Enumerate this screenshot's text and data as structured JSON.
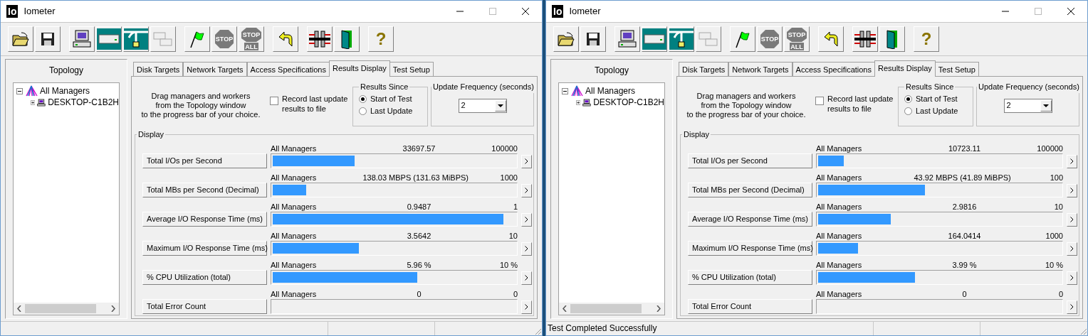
{
  "windows": [
    {
      "title": "Iometer",
      "logo": "Io",
      "toolbar": [
        [
          {
            "kind": "open",
            "disabled": false
          },
          {
            "kind": "save",
            "disabled": false
          }
        ],
        [
          {
            "kind": "manager",
            "disabled": false
          },
          {
            "kind": "disk-worker",
            "disabled": false
          },
          {
            "kind": "network-worker",
            "disabled": false
          },
          {
            "kind": "duplicate",
            "disabled": true
          }
        ],
        [
          {
            "kind": "start",
            "disabled": false
          },
          {
            "kind": "stop",
            "disabled": true,
            "text": "STOP"
          },
          {
            "kind": "stop-all",
            "disabled": true,
            "text": "STOP",
            "subtext": "ALL"
          }
        ],
        [
          {
            "kind": "reset",
            "disabled": false
          }
        ],
        [
          {
            "kind": "workers",
            "disabled": false
          },
          {
            "kind": "exit",
            "disabled": false
          }
        ],
        [
          {
            "kind": "help",
            "disabled": false,
            "text": "?"
          }
        ]
      ],
      "topology": {
        "title": "Topology",
        "tree": [
          {
            "label": "All Managers",
            "expanded": true,
            "children": [
              {
                "label": "DESKTOP-C1B2H",
                "expanded": false
              }
            ]
          }
        ]
      },
      "tabs": [
        {
          "label": "Disk Targets",
          "selected": false
        },
        {
          "label": "Network Targets",
          "selected": false
        },
        {
          "label": "Access Specifications",
          "selected": false
        },
        {
          "label": "Results Display",
          "selected": true
        },
        {
          "label": "Test Setup",
          "selected": false
        }
      ],
      "hint_lines": [
        "Drag managers and workers",
        "from the Topology window",
        "to the progress bar of your choice."
      ],
      "record": {
        "label": "Record last update results to file",
        "checked": false
      },
      "results_since": {
        "title": "Results Since",
        "options": [
          {
            "label": "Start of Test",
            "selected": true
          },
          {
            "label": "Last Update",
            "selected": false
          }
        ]
      },
      "update_frequency": {
        "title": "Update Frequency (seconds)",
        "value": "2"
      },
      "display": {
        "title": "Display",
        "rows": [
          {
            "button": "Total I/Os per Second",
            "source": "All Managers",
            "reading": "33697.57",
            "max": "100000",
            "level": 0.337
          },
          {
            "button": "Total MBs per Second (Decimal)",
            "source": "All Managers",
            "reading": "138.03 MBPS (131.63 MiBPS)",
            "max": "1000",
            "level": 0.138
          },
          {
            "button": "Average I/O Response Time (ms)",
            "source": "All Managers",
            "reading": "0.9487",
            "max": "1",
            "level": 0.9487
          },
          {
            "button": "Maximum I/O Response Time (ms)",
            "source": "All Managers",
            "reading": "3.5642",
            "max": "10",
            "level": 0.356
          },
          {
            "button": "% CPU Utilization (total)",
            "source": "All Managers",
            "reading": "5.96 %",
            "max": "10 %",
            "level": 0.596
          },
          {
            "button": "Total Error Count",
            "source": "All Managers",
            "reading": "0",
            "max": "0",
            "level": 0
          }
        ]
      }
    },
    {
      "title": "Iometer",
      "logo": "Io",
      "toolbar": [
        [
          {
            "kind": "open",
            "disabled": false
          },
          {
            "kind": "save",
            "disabled": false
          }
        ],
        [
          {
            "kind": "manager",
            "disabled": false
          },
          {
            "kind": "disk-worker",
            "disabled": false
          },
          {
            "kind": "network-worker",
            "disabled": false
          },
          {
            "kind": "duplicate",
            "disabled": true
          }
        ],
        [
          {
            "kind": "start",
            "disabled": false
          },
          {
            "kind": "stop",
            "disabled": true,
            "text": "STOP"
          },
          {
            "kind": "stop-all",
            "disabled": true,
            "text": "STOP",
            "subtext": "ALL"
          }
        ],
        [
          {
            "kind": "reset",
            "disabled": false
          }
        ],
        [
          {
            "kind": "workers",
            "disabled": false
          },
          {
            "kind": "exit",
            "disabled": false
          }
        ],
        [
          {
            "kind": "help",
            "disabled": false,
            "text": "?"
          }
        ]
      ],
      "topology": {
        "title": "Topology",
        "tree": [
          {
            "label": "All Managers",
            "expanded": true,
            "children": [
              {
                "label": "DESKTOP-C1B2H",
                "expanded": false
              }
            ]
          }
        ]
      },
      "tabs": [
        {
          "label": "Disk Targets",
          "selected": false
        },
        {
          "label": "Network Targets",
          "selected": false
        },
        {
          "label": "Access Specifications",
          "selected": false
        },
        {
          "label": "Results Display",
          "selected": true
        },
        {
          "label": "Test Setup",
          "selected": false
        }
      ],
      "hint_lines": [
        "Drag managers and workers",
        "from the Topology window",
        "to the progress bar of your choice."
      ],
      "record": {
        "label": "Record last update results to file",
        "checked": false
      },
      "results_since": {
        "title": "Results Since",
        "options": [
          {
            "label": "Start of Test",
            "selected": true
          },
          {
            "label": "Last Update",
            "selected": false
          }
        ]
      },
      "update_frequency": {
        "title": "Update Frequency (seconds)",
        "value": "2"
      },
      "display": {
        "title": "Display",
        "rows": [
          {
            "button": "Total I/Os per Second",
            "source": "All Managers",
            "reading": "10723.11",
            "max": "100000",
            "level": 0.107
          },
          {
            "button": "Total MBs per Second (Decimal)",
            "source": "All Managers",
            "reading": "43.92 MBPS (41.89 MiBPS)",
            "max": "100",
            "level": 0.439
          },
          {
            "button": "Average I/O Response Time (ms)",
            "source": "All Managers",
            "reading": "2.9816",
            "max": "10",
            "level": 0.298
          },
          {
            "button": "Maximum I/O Response Time (ms)",
            "source": "All Managers",
            "reading": "164.0414",
            "max": "1000",
            "level": 0.164
          },
          {
            "button": "% CPU Utilization (total)",
            "source": "All Managers",
            "reading": "3.99 %",
            "max": "10 %",
            "level": 0.399
          },
          {
            "button": "Total Error Count",
            "source": "All Managers",
            "reading": "0",
            "max": "0",
            "level": 0
          }
        ]
      },
      "status": [
        {
          "text": "Test Completed Successfully"
        }
      ]
    }
  ]
}
